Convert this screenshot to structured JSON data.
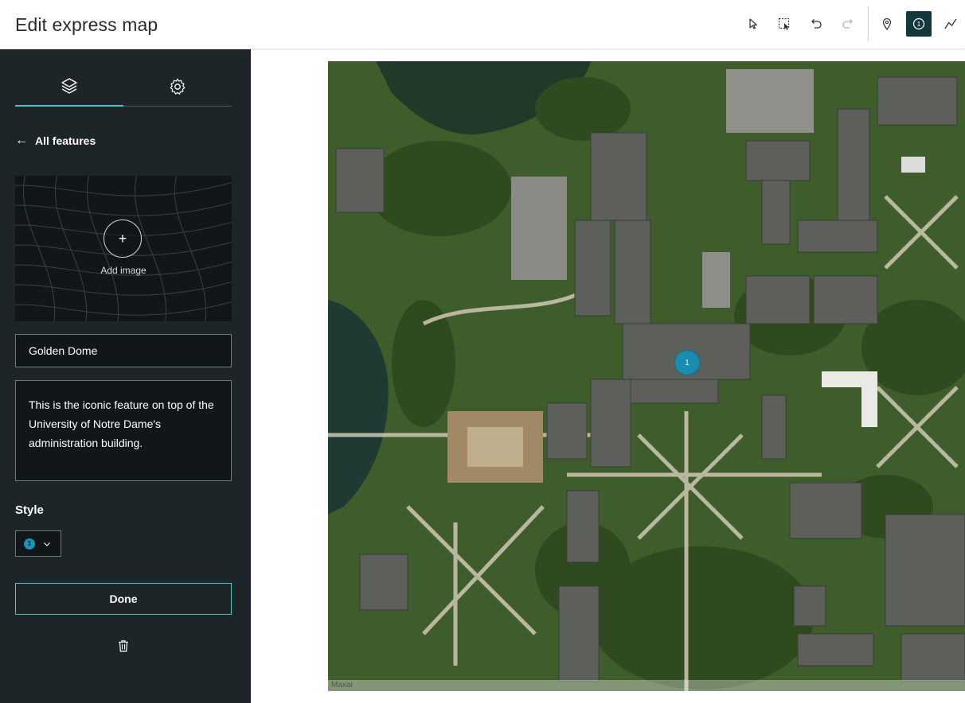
{
  "header": {
    "title": "Edit express map",
    "tools": [
      {
        "name": "select-tool",
        "icon": "cursor-icon"
      },
      {
        "name": "lasso-select-tool",
        "icon": "select-rectangle-icon"
      },
      {
        "name": "undo-tool",
        "icon": "undo-icon"
      },
      {
        "name": "redo-tool",
        "icon": "redo-icon"
      },
      {
        "name": "pin-tool",
        "icon": "pin-icon"
      },
      {
        "name": "numbered-marker-tool",
        "icon": "numbered-marker-icon",
        "active": true
      },
      {
        "name": "line-tool",
        "icon": "polyline-icon"
      }
    ]
  },
  "sidebar": {
    "tabs": [
      {
        "icon": "layers-icon",
        "selected": true
      },
      {
        "icon": "gear-icon",
        "selected": false
      }
    ],
    "back_label": "All features",
    "image": {
      "add_label": "Add image",
      "add_symbol": "+"
    },
    "title_value": "Golden Dome",
    "description_value": "This is the iconic feature on top of the University of Notre Dame's administration building.",
    "style_label": "Style",
    "style_marker_number": "1",
    "done_label": "Done"
  },
  "map": {
    "attribution": "Maxar",
    "marker_number": "1"
  },
  "colors": {
    "sidebar_bg": "#1d2528",
    "accent": "#4fc3c8",
    "active_tool": "#13383c",
    "marker": "#1a8cb0"
  }
}
